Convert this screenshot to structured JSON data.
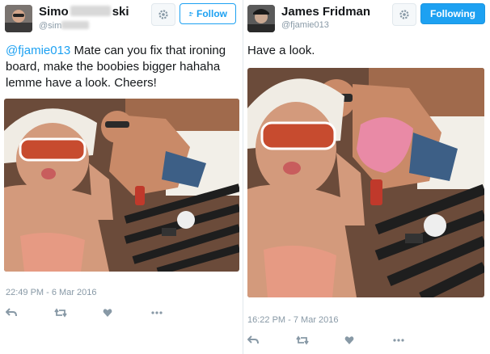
{
  "left_tweet": {
    "name_prefix": "Simo",
    "name_suffix": "ski",
    "handle_prefix": "@sim",
    "follow_label": "Follow",
    "mention": "@fjamie013",
    "text": " Mate can you fix that ironing board, make the boobies bigger hahaha lemme have a look. Cheers!",
    "timestamp": "22:49 PM - 6 Mar 2016",
    "actions": [
      "reply-icon",
      "retweet-icon",
      "like-icon",
      "more-icon"
    ]
  },
  "right_tweet": {
    "name": "James Fridman",
    "handle": "@fjamie013",
    "follow_label": "Following",
    "text": "Have a look.",
    "timestamp": "16:22 PM - 7 Mar 2016",
    "actions": [
      "reply-icon",
      "retweet-icon",
      "like-icon",
      "more-icon"
    ]
  },
  "colors": {
    "accent": "#1da1f2",
    "text": "#14171a",
    "muted": "#8899a6",
    "border": "#e1e8ed"
  }
}
